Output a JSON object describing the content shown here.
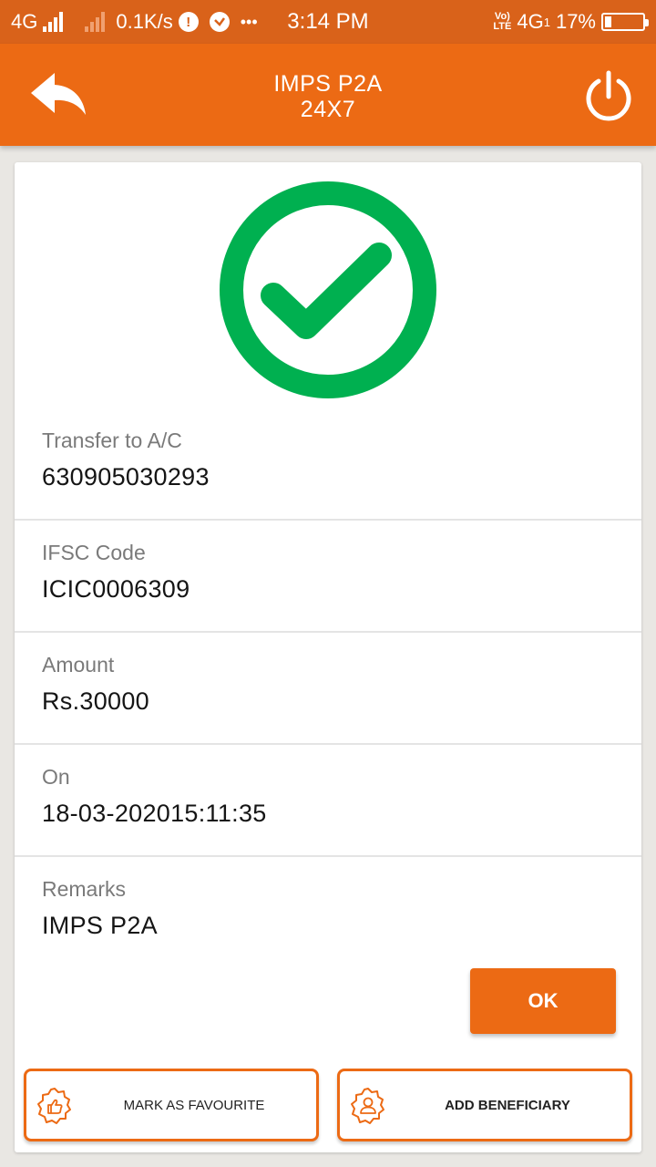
{
  "status_bar": {
    "network_1": "4G",
    "speed": "0.1K/s",
    "time": "3:14 PM",
    "volte_top": "Vo)",
    "volte_bottom": "LTE",
    "network_2": "4G",
    "sim_index": "1",
    "battery_percent": "17%",
    "battery_level": 0.17,
    "more": "•••",
    "alert_glyph": "!"
  },
  "header": {
    "title_line1": "IMPS P2A",
    "title_line2": "24X7",
    "back_icon": "back-arrow-icon",
    "power_icon": "power-icon"
  },
  "success_icon": "check-circle-icon",
  "details": [
    {
      "label": "Transfer to A/C",
      "value": "630905030293"
    },
    {
      "label": "IFSC Code",
      "value": "ICIC0006309"
    },
    {
      "label": "Amount",
      "value": "Rs.30000"
    },
    {
      "label": "On",
      "value": "18-03-202015:11:35"
    },
    {
      "label": "Remarks",
      "value": "IMPS P2A"
    }
  ],
  "ok_label": "OK",
  "actions": {
    "favourite_label": "MARK AS FAVOURITE",
    "favourite_icon": "thumbs-up-badge-icon",
    "beneficiary_label": "ADD BENEFICIARY",
    "beneficiary_icon": "user-badge-icon"
  },
  "colors": {
    "primary": "#ec6a14",
    "status_bar": "#d9621a",
    "success": "#00b050",
    "background": "#e9e7e3"
  }
}
